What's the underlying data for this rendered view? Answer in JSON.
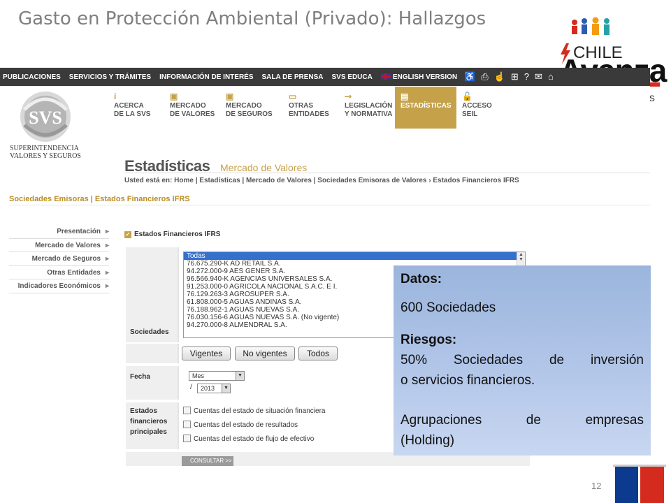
{
  "slide": {
    "title": "Gasto en Protección Ambiental (Privado): Hallazgos",
    "page_number": "12"
  },
  "logo": {
    "chile": "CHILE",
    "avanza": "Avanza",
    "tail": "os"
  },
  "topnav": {
    "items": [
      "PUBLICACIONES",
      "SERVICIOS Y TRÁMITES",
      "INFORMACIÓN DE INTERÉS",
      "SALA DE PRENSA",
      "SVS EDUCA",
      "ENGLISH VERSION"
    ],
    "icons": [
      "accessibility-icon",
      "print-icon",
      "hand-icon",
      "sitemap-icon",
      "help-icon",
      "mail-icon",
      "home-icon"
    ]
  },
  "svs": {
    "logo_text": "SVS",
    "caption_line1": "SUPERINTENDENCIA",
    "caption_line2": "VALORES Y SEGUROS"
  },
  "mainnav": {
    "items": [
      {
        "l1": "ACERCA",
        "l2": "DE LA SVS"
      },
      {
        "l1": "MERCADO",
        "l2": "DE VALORES"
      },
      {
        "l1": "MERCADO",
        "l2": "DE SEGUROS"
      },
      {
        "l1": "OTRAS",
        "l2": "ENTIDADES"
      },
      {
        "l1": "LEGISLACIÓN",
        "l2": "Y NORMATIVA"
      },
      {
        "l1": "",
        "l2": "ESTADÍSTICAS"
      },
      {
        "l1": "ACCESO",
        "l2": "SEIL"
      }
    ],
    "active_color": "#c5a24a"
  },
  "page": {
    "title": "Estadísticas",
    "subtitle": "Mercado de Valores",
    "breadcrumb": "Usted está en: Home | Estadísticas | Mercado de Valores | Sociedades Emisoras de Valores  ›  Estados Financieros IFRS",
    "section_title": "Sociedades Emisoras | Estados Financieros IFRS"
  },
  "sidemenu": {
    "items": [
      "Presentación",
      "Mercado de Valores",
      "Mercado de Seguros",
      "Otras Entidades",
      "Indicadores Económicos"
    ]
  },
  "form": {
    "header": "Estados Financieros IFRS",
    "sociedades_label": "Sociedades",
    "companies": [
      "Todas",
      "76.675.290-K AD RETAIL S.A.",
      "94.272.000-9 AES GENER S.A.",
      "96.566.940-K AGENCIAS UNIVERSALES S.A.",
      "91.253.000-0 AGRICOLA NACIONAL S.A.C. E I.",
      "76.129.263-3 AGROSUPER S.A.",
      "61.808.000-5 AGUAS ANDINAS S.A.",
      "76.188.962-1 AGUAS NUEVAS S.A.",
      "76.030.156-6 AGUAS NUEVAS S.A. (No vigente)",
      "94.270.000-8 ALMENDRAL S.A."
    ],
    "buttons": [
      "Vigentes",
      "No vigentes",
      "Todos"
    ],
    "fecha_label": "Fecha",
    "mes_value": "Mes",
    "slash": "/",
    "year_value": "2013",
    "estados_label_1": "Estados",
    "estados_label_2": "financieros",
    "estados_label_3": "principales",
    "checkboxes": [
      "Cuentas del estado de situación financiera",
      "Cuentas del estado de resultados",
      "Cuentas del estado de flujo de efectivo"
    ],
    "consultar": "CONSULTAR  >>"
  },
  "callout": {
    "datos_heading": "Datos:",
    "datos_value": "600 Sociedades",
    "riesgos_heading": "Riesgos:",
    "riesgos_line1": "50% Sociedades de inversión",
    "riesgos_line2": "o servicios financieros.",
    "agrup_line1": "Agrupaciones de empresas",
    "agrup_line2": "(Holding)"
  }
}
